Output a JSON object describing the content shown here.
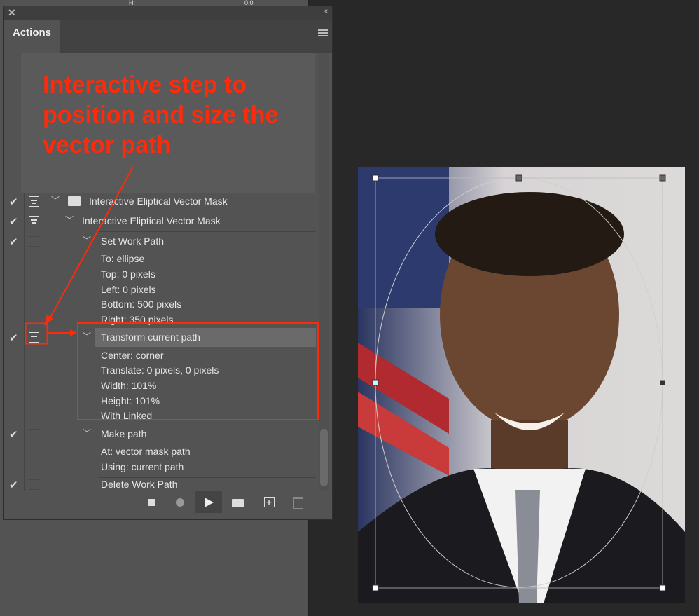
{
  "behind_panel": {
    "label": "H:",
    "value": "0.0"
  },
  "panel": {
    "close_icon": "close-icon",
    "collapse_icon": "double-chevron-left-icon",
    "tab": "Actions",
    "menu_icon": "hamburger-icon"
  },
  "annotation": {
    "text": "Interactive step to position and size the vector path",
    "color": "#ff2a0a"
  },
  "rows": [
    {
      "label": "Interactive Eliptical Vector Mask",
      "checked": true,
      "dialog": "on",
      "type": "set"
    },
    {
      "label": "Interactive Eliptical Vector Mask",
      "checked": true,
      "dialog": "on",
      "type": "action"
    },
    {
      "label": "Set Work Path",
      "checked": true,
      "dialog": "off",
      "type": "step"
    },
    {
      "label": "To: ellipse",
      "type": "param"
    },
    {
      "label": "Top: 0 pixels",
      "type": "param"
    },
    {
      "label": "Left: 0 pixels",
      "type": "param"
    },
    {
      "label": "Bottom: 500 pixels",
      "type": "param"
    },
    {
      "label": "Right: 350 pixels",
      "type": "param"
    },
    {
      "label": "Transform current path",
      "checked": true,
      "dialog": "on",
      "type": "step",
      "selected": true
    },
    {
      "label": "Center: corner",
      "type": "param"
    },
    {
      "label": "Translate: 0 pixels, 0 pixels",
      "type": "param"
    },
    {
      "label": "Width: 101%",
      "type": "param"
    },
    {
      "label": "Height: 101%",
      "type": "param"
    },
    {
      "label": "With Linked",
      "type": "param"
    },
    {
      "label": "Make path",
      "checked": true,
      "dialog": "off",
      "type": "step"
    },
    {
      "label": "At: vector mask path",
      "type": "param"
    },
    {
      "label": "Using: current path",
      "type": "param"
    },
    {
      "label": "Delete Work Path",
      "checked": true,
      "dialog": "off",
      "type": "step"
    }
  ],
  "footer": {
    "buttons": [
      "stop-icon",
      "record-icon",
      "play-icon",
      "folder-icon",
      "new-action-icon",
      "trash-icon"
    ]
  }
}
